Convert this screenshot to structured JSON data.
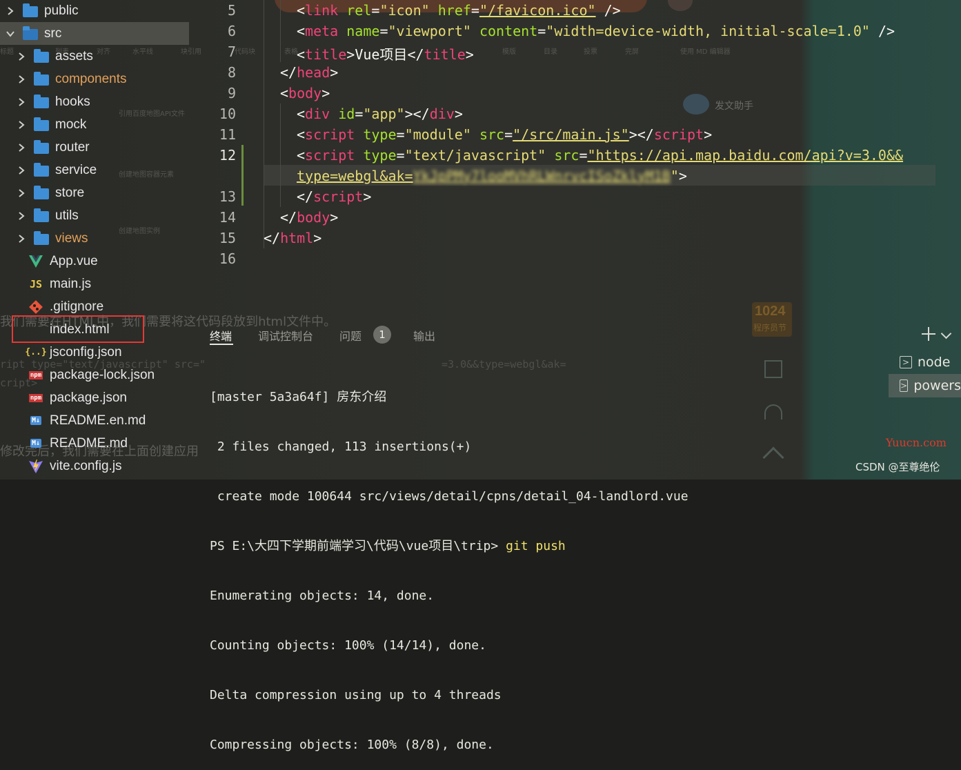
{
  "explorer": {
    "items": [
      {
        "label": "public",
        "kind": "folder",
        "expanded": false
      },
      {
        "label": "src",
        "kind": "folder-open",
        "expanded": true
      },
      {
        "label": "assets",
        "kind": "folder",
        "expanded": false
      },
      {
        "label": "components",
        "kind": "folder",
        "expanded": false
      },
      {
        "label": "hooks",
        "kind": "folder",
        "expanded": false
      },
      {
        "label": "mock",
        "kind": "folder",
        "expanded": false
      },
      {
        "label": "router",
        "kind": "folder",
        "expanded": false
      },
      {
        "label": "service",
        "kind": "folder",
        "expanded": false
      },
      {
        "label": "store",
        "kind": "folder",
        "expanded": false
      },
      {
        "label": "utils",
        "kind": "folder",
        "expanded": false
      },
      {
        "label": "views",
        "kind": "folder",
        "expanded": false
      },
      {
        "label": "App.vue",
        "kind": "vue"
      },
      {
        "label": "main.js",
        "kind": "js"
      },
      {
        "label": ".gitignore",
        "kind": "git"
      },
      {
        "label": "index.html",
        "kind": "html"
      },
      {
        "label": "jsconfig.json",
        "kind": "json"
      },
      {
        "label": "package-lock.json",
        "kind": "npm"
      },
      {
        "label": "package.json",
        "kind": "npm"
      },
      {
        "label": "README.en.md",
        "kind": "md"
      },
      {
        "label": "README.md",
        "kind": "md"
      },
      {
        "label": "vite.config.js",
        "kind": "vite"
      }
    ],
    "badges": {
      "js": "JS",
      "json": "{..}",
      "npm": "npm",
      "md": "M↓",
      "html": "</>"
    },
    "icon_names": {
      "folder": "folder-icon",
      "vue": "vue-icon",
      "js": "js-file-icon",
      "git": "git-icon",
      "html": "html-file-icon",
      "json": "json-file-icon",
      "npm": "npm-icon",
      "md": "markdown-icon",
      "vite": "vite-icon"
    },
    "colors": {
      "modified_folder": "#e2a05a",
      "folder": "#3f8fd6",
      "highlight_box": "#e53935"
    }
  },
  "editor": {
    "line_numbers": [
      "5",
      "6",
      "7",
      "8",
      "9",
      "10",
      "11",
      "12",
      "",
      "13",
      "14",
      "15",
      "16"
    ],
    "code": {
      "l5": {
        "o": "<",
        "tag": "link",
        "a1": "rel",
        "v1": "\"icon\"",
        "a2": "href",
        "v2": "\"/favicon.ico\"",
        "c": "/>"
      },
      "l6": {
        "o": "<",
        "tag": "meta",
        "a1": "name",
        "v1": "\"viewport\"",
        "a2": "content",
        "v2": "\"width=device-width, initial-scale=1.0\"",
        "c": "/>"
      },
      "l7": {
        "o": "<",
        "tag": "title",
        "m": ">",
        "text": "Vue项目",
        "o2": "</",
        "tag2": "title",
        "c": ">"
      },
      "l8": {
        "o": "</",
        "tag": "head",
        "c": ">"
      },
      "l9": {
        "o": "<",
        "tag": "body",
        "c": ">"
      },
      "l10": {
        "o": "<",
        "tag": "div",
        "a1": "id",
        "eq": "=",
        "v1": "\"app\"",
        "m": "></",
        "tag2": "div",
        "c": ">"
      },
      "l11": {
        "o": "<",
        "tag": "script",
        "a1": "type",
        "v1": "\"module\"",
        "a2": "src",
        "v2": "\"/src/main.js\"",
        "m": "></",
        "tag2": "script",
        "c": ">"
      },
      "l12": {
        "o": "<",
        "tag": "script",
        "a1": "type",
        "v1": "\"text/javascript\"",
        "a2": "src",
        "v2": "\"https://api.map.baidu.com/api?v=3.0&&"
      },
      "l12b": {
        "v": "type=webgl&ak=",
        "key": "YkJpPMy7looMVhRLWnrvcISoZklyM1B",
        "q": "\"",
        "c": ">"
      },
      "l13": {
        "o": "</",
        "tag": "script",
        "c": ">"
      },
      "l14": {
        "o": "</",
        "tag": "body",
        "c": ">"
      },
      "l15": {
        "o": "</",
        "tag": "html",
        "c": ">"
      },
      "eq": "="
    },
    "colors": {
      "tag": "#f0437a",
      "attr": "#a6e22e",
      "string": "#e6db74",
      "punct": "#f8f8f2"
    }
  },
  "panel": {
    "tabs": [
      {
        "label": "终端",
        "active": true
      },
      {
        "label": "调试控制台",
        "active": false
      },
      {
        "label": "问题",
        "active": false,
        "count": "1"
      },
      {
        "label": "输出",
        "active": false
      }
    ],
    "terminal_lines": [
      "[master 5a3a64f] 房东介绍",
      " 2 files changed, 113 insertions(+)",
      " create mode 100644 src/views/detail/cpns/detail_04-landlord.vue",
      "PS E:\\大四下学期前端学习\\代码\\vue项目\\trip> ",
      "Enumerating objects: 14, done.",
      "Counting objects: 100% (14/14), done.",
      "Delta compression using up to 4 threads",
      "Compressing objects: 100% (8/8), done."
    ],
    "git_command": "git push",
    "add_icon": "plus-icon",
    "dropdown_icon": "chevron-down-icon",
    "terminals": [
      {
        "label": "node",
        "selected": false
      },
      {
        "label": "powers",
        "selected": true
      }
    ]
  },
  "background": {
    "toolbar": [
      "标题",
      "列表",
      "对齐",
      "水平线",
      "块引用",
      "代码块",
      "表格",
      "目录",
      "草稿箱",
      "模版",
      "目录",
      "投票",
      "完屏",
      "使用 MD 编辑器"
    ],
    "assistant": "发文助手",
    "paragraph1": "我们需要在HTML中，我们需要将这代码段放到html文件中。",
    "paragraph2": "修改完后，我们需要在上面创建应用",
    "code_behind": "ript type=\"text/javascript\" src=\"",
    "code_behind2": "=3.0&&type=webgl&ak=",
    "code_behind3": "cript>",
    "step3": "引用百度地图API文件",
    "step4": "创建地图容器元素",
    "step5": "创建地图实例",
    "badge_1024": "1024",
    "badge_sub": "程序员节",
    "watermark1": "Yuucn.com",
    "watermark2": "CSDN @至尊绝伦"
  }
}
